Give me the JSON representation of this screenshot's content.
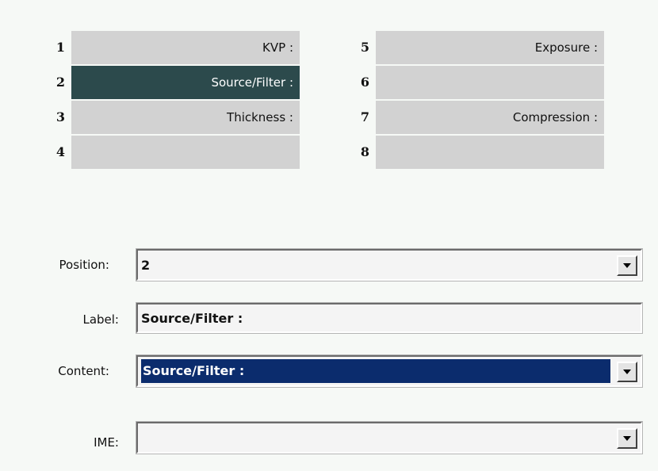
{
  "slots": [
    {
      "number": "1",
      "label": "KVP :"
    },
    {
      "number": "2",
      "label": "Source/Filter :"
    },
    {
      "number": "3",
      "label": "Thickness :"
    },
    {
      "number": "4",
      "label": ""
    },
    {
      "number": "5",
      "label": "Exposure :"
    },
    {
      "number": "6",
      "label": ""
    },
    {
      "number": "7",
      "label": "Compression :"
    },
    {
      "number": "8",
      "label": ""
    }
  ],
  "selected_slot": "2",
  "form": {
    "position": {
      "label": "Position:",
      "value": "2"
    },
    "label": {
      "label": "Label:",
      "value": "Source/Filter :"
    },
    "content": {
      "label": "Content:",
      "value": "Source/Filter :"
    },
    "ime": {
      "label": "IME:",
      "value": ""
    }
  },
  "icons": {
    "dropdown": "chevron-down-icon"
  },
  "colors": {
    "selected_slot_bg": "#2c4a4c",
    "highlight_bg": "#0b2c6d",
    "slot_bg": "#d2d2d2"
  }
}
